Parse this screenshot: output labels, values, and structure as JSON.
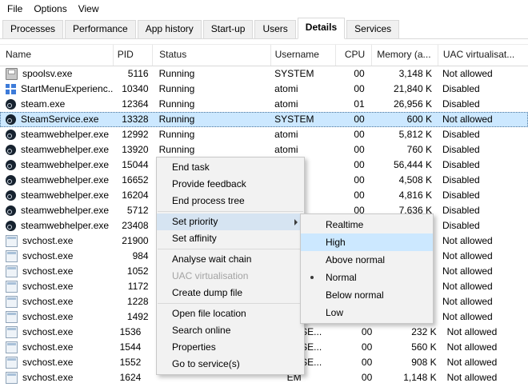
{
  "menubar": {
    "items": [
      {
        "label": "File"
      },
      {
        "label": "Options"
      },
      {
        "label": "View"
      }
    ]
  },
  "tabs": [
    {
      "label": "Processes",
      "active": false
    },
    {
      "label": "Performance",
      "active": false
    },
    {
      "label": "App history",
      "active": false
    },
    {
      "label": "Start-up",
      "active": false
    },
    {
      "label": "Users",
      "active": false
    },
    {
      "label": "Details",
      "active": true
    },
    {
      "label": "Services",
      "active": false
    }
  ],
  "table": {
    "columns": [
      {
        "id": "name",
        "label": "Name"
      },
      {
        "id": "pid",
        "label": "PID"
      },
      {
        "id": "status",
        "label": "Status"
      },
      {
        "id": "username",
        "label": "Username"
      },
      {
        "id": "cpu",
        "label": "CPU"
      },
      {
        "id": "memory",
        "label": "Memory (a..."
      },
      {
        "id": "uac",
        "label": "UAC virtualisat..."
      }
    ],
    "rows": [
      {
        "icon": "printer",
        "name": "spoolsv.exe",
        "pid": "5116",
        "status": "Running",
        "username": "SYSTEM",
        "cpu": "00",
        "memory": "3,148 K",
        "uac": "Not allowed",
        "selected": false
      },
      {
        "icon": "window",
        "name": "StartMenuExperienc...",
        "pid": "10340",
        "status": "Running",
        "username": "atomi",
        "cpu": "00",
        "memory": "21,840 K",
        "uac": "Disabled",
        "selected": false
      },
      {
        "icon": "steam",
        "name": "steam.exe",
        "pid": "12364",
        "status": "Running",
        "username": "atomi",
        "cpu": "01",
        "memory": "26,956 K",
        "uac": "Disabled",
        "selected": false
      },
      {
        "icon": "steam",
        "name": "SteamService.exe",
        "pid": "13328",
        "status": "Running",
        "username": "SYSTEM",
        "cpu": "00",
        "memory": "600 K",
        "uac": "Not allowed",
        "selected": true
      },
      {
        "icon": "steam",
        "name": "steamwebhelper.exe",
        "pid": "12992",
        "status": "Running",
        "username": "atomi",
        "cpu": "00",
        "memory": "5,812 K",
        "uac": "Disabled",
        "selected": false
      },
      {
        "icon": "steam",
        "name": "steamwebhelper.exe",
        "pid": "13920",
        "status": "Running",
        "username": "atomi",
        "cpu": "00",
        "memory": "760 K",
        "uac": "Disabled",
        "selected": false
      },
      {
        "icon": "steam",
        "name": "steamwebhelper.exe",
        "pid": "15044",
        "status": "",
        "username": "",
        "cpu": "00",
        "memory": "56,444 K",
        "uac": "Disabled",
        "selected": false
      },
      {
        "icon": "steam",
        "name": "steamwebhelper.exe",
        "pid": "16652",
        "status": "",
        "username": "",
        "cpu": "00",
        "memory": "4,508 K",
        "uac": "Disabled",
        "selected": false
      },
      {
        "icon": "steam",
        "name": "steamwebhelper.exe",
        "pid": "16204",
        "status": "",
        "username": "",
        "cpu": "00",
        "memory": "4,816 K",
        "uac": "Disabled",
        "selected": false
      },
      {
        "icon": "steam",
        "name": "steamwebhelper.exe",
        "pid": "5712",
        "status": "",
        "username": "",
        "cpu": "00",
        "memory": "7,636 K",
        "uac": "Disabled",
        "selected": false
      },
      {
        "icon": "steam",
        "name": "steamwebhelper.exe",
        "pid": "23408",
        "status": "",
        "username": "",
        "cpu": "",
        "memory": "",
        "uac": "Disabled",
        "selected": false
      },
      {
        "icon": "svchost",
        "name": "svchost.exe",
        "pid": "21900",
        "status": "",
        "username": "",
        "cpu": "",
        "memory": "",
        "uac": "Not allowed",
        "selected": false
      },
      {
        "icon": "svchost",
        "name": "svchost.exe",
        "pid": "984",
        "status": "",
        "username": "",
        "cpu": "",
        "memory": "",
        "uac": "Not allowed",
        "selected": false
      },
      {
        "icon": "svchost",
        "name": "svchost.exe",
        "pid": "1052",
        "status": "",
        "username": "",
        "cpu": "",
        "memory": "",
        "uac": "Not allowed",
        "selected": false
      },
      {
        "icon": "svchost",
        "name": "svchost.exe",
        "pid": "1172",
        "status": "",
        "username": "",
        "cpu": "",
        "memory": "",
        "uac": "Not allowed",
        "selected": false
      },
      {
        "icon": "svchost",
        "name": "svchost.exe",
        "pid": "1228",
        "status": "",
        "username": "",
        "cpu": "",
        "memory": "",
        "uac": "Not allowed",
        "selected": false
      },
      {
        "icon": "svchost",
        "name": "svchost.exe",
        "pid": "1492",
        "status": "",
        "username": "",
        "cpu": "",
        "memory": "",
        "uac": "Not allowed",
        "selected": false
      },
      {
        "icon": "svchost",
        "name": "svchost.exe",
        "pid": "1536",
        "status": "",
        "username": "AL SE...",
        "username_fragment": true,
        "cpu": "00",
        "memory": "232 K",
        "uac": "Not allowed",
        "selected": false
      },
      {
        "icon": "svchost",
        "name": "svchost.exe",
        "pid": "1544",
        "status": "",
        "username": "AL SE...",
        "username_fragment": true,
        "cpu": "00",
        "memory": "560 K",
        "uac": "Not allowed",
        "selected": false
      },
      {
        "icon": "svchost",
        "name": "svchost.exe",
        "pid": "1552",
        "status": "",
        "username": "AL SE...",
        "username_fragment": true,
        "cpu": "00",
        "memory": "908 K",
        "uac": "Not allowed",
        "selected": false
      },
      {
        "icon": "svchost",
        "name": "svchost.exe",
        "pid": "1624",
        "status": "",
        "username": "EM",
        "username_fragment": true,
        "cpu": "00",
        "memory": "1,148 K",
        "uac": "Not allowed",
        "selected": false
      }
    ]
  },
  "context_menu": {
    "items": [
      {
        "type": "item",
        "label": "End task"
      },
      {
        "type": "item",
        "label": "Provide feedback"
      },
      {
        "type": "item",
        "label": "End process tree"
      },
      {
        "type": "separator"
      },
      {
        "type": "item",
        "label": "Set priority",
        "highlighted": true,
        "has_submenu": true
      },
      {
        "type": "item",
        "label": "Set affinity"
      },
      {
        "type": "separator"
      },
      {
        "type": "item",
        "label": "Analyse wait chain"
      },
      {
        "type": "item",
        "label": "UAC virtualisation",
        "disabled": true
      },
      {
        "type": "item",
        "label": "Create dump file"
      },
      {
        "type": "separator"
      },
      {
        "type": "item",
        "label": "Open file location"
      },
      {
        "type": "item",
        "label": "Search online"
      },
      {
        "type": "item",
        "label": "Properties"
      },
      {
        "type": "item",
        "label": "Go to service(s)"
      }
    ]
  },
  "priority_submenu": {
    "items": [
      {
        "label": "Realtime"
      },
      {
        "label": "High",
        "highlighted": true
      },
      {
        "label": "Above normal"
      },
      {
        "label": "Normal",
        "checked": true
      },
      {
        "label": "Below normal"
      },
      {
        "label": "Low"
      }
    ]
  },
  "colors": {
    "selection_bg": "#cce8ff",
    "menu_bg": "#f2f2f2",
    "menu_border": "#c8c8c8",
    "menu_highlight": "#cce8ff",
    "menu_parent_highlight": "#d6e4f2",
    "header_border": "#d9d9d9",
    "tab_border": "#d9d9d9"
  }
}
